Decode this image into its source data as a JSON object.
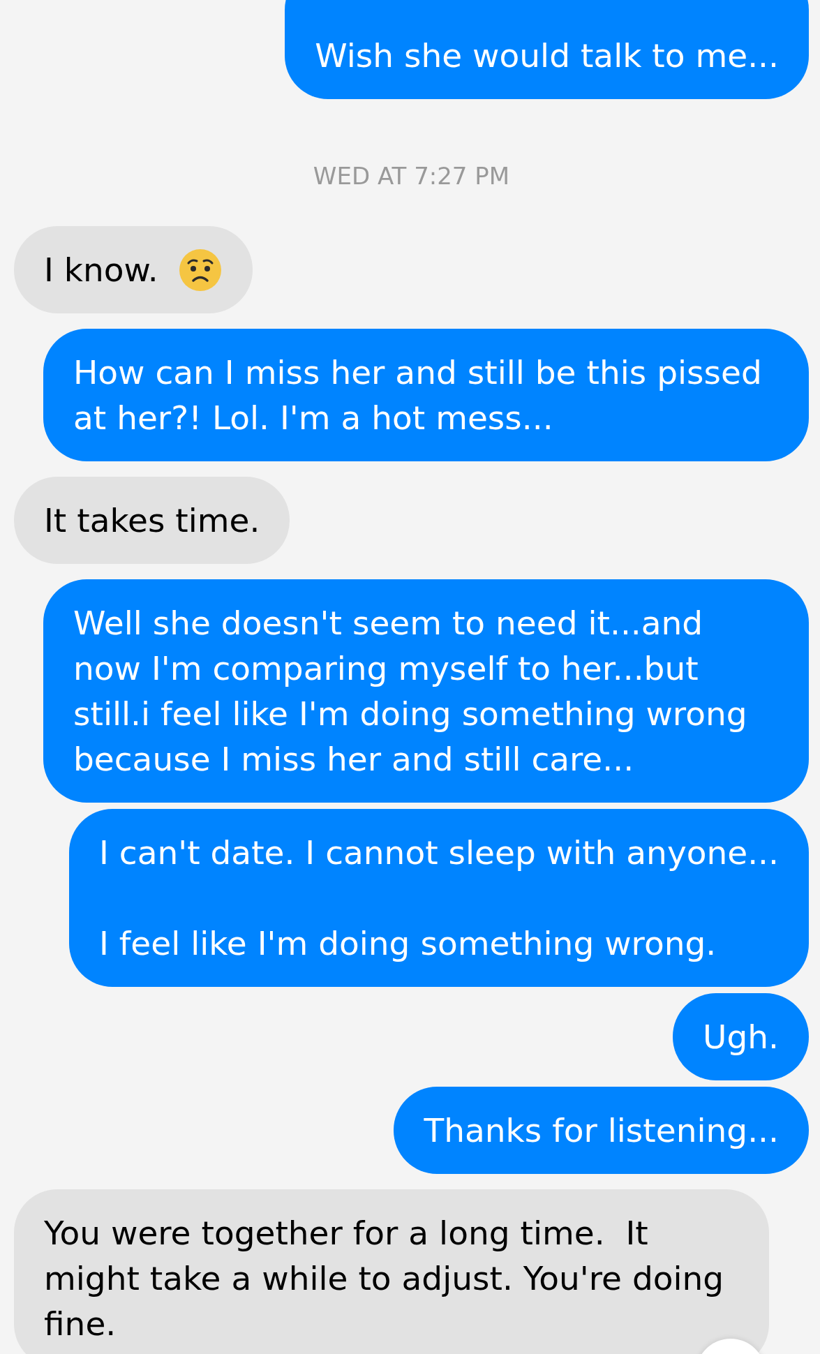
{
  "messages": [
    {
      "kind": "sent",
      "text": "Wish she would talk to me...",
      "has_emoji": false
    },
    {
      "kind": "timestamp",
      "text": "WED AT 7:27 PM"
    },
    {
      "kind": "received",
      "text": "I know.",
      "has_emoji": true
    },
    {
      "kind": "sent",
      "text": "How can I miss her and still be this pissed at her?! Lol. I'm a hot mess...",
      "has_emoji": false
    },
    {
      "kind": "received",
      "text": "It takes time.",
      "has_emoji": false
    },
    {
      "kind": "sent",
      "text": "Well she doesn't seem to need it...and now I'm comparing myself to her...but still.i feel like I'm doing something wrong because I miss her and still care...",
      "has_emoji": false
    },
    {
      "kind": "sent",
      "text": "I can't date. I cannot sleep with anyone...\n\nI feel like I'm doing something wrong.",
      "has_emoji": false
    },
    {
      "kind": "sent",
      "text": "Ugh.",
      "has_emoji": false
    },
    {
      "kind": "sent",
      "text": "Thanks for listening...",
      "has_emoji": false
    },
    {
      "kind": "received",
      "text": "You were together for a long time.  It might take a while to adjust. You're doing fine.",
      "has_emoji": false
    }
  ]
}
